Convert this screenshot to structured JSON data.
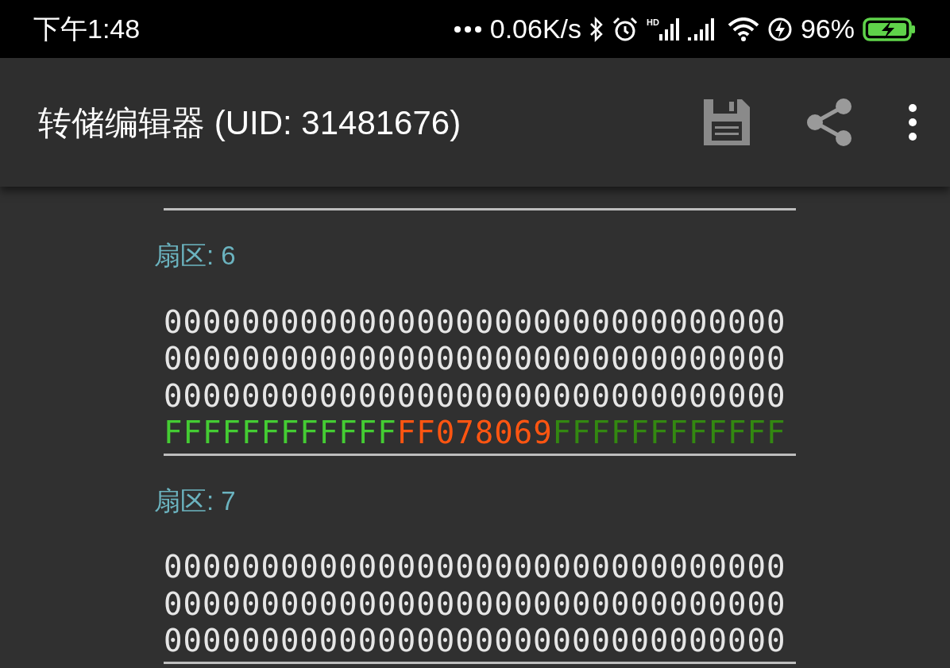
{
  "status_bar": {
    "time": "下午1:48",
    "speed": "0.06K/s",
    "signal_label": "HD",
    "battery": "96%"
  },
  "app_bar": {
    "title": "转储编辑器 (UID: 31481676)"
  },
  "sectors": [
    {
      "label": "扇区: 6",
      "rows": [
        {
          "kind": "data",
          "text": "00000000000000000000000000000000"
        },
        {
          "kind": "data",
          "text": "00000000000000000000000000000000"
        },
        {
          "kind": "data",
          "text": "00000000000000000000000000000000"
        },
        {
          "kind": "trailer",
          "segments": [
            {
              "text": "FFFFFFFFFFFF",
              "color": "#44cc33"
            },
            {
              "text": "FF078069",
              "color": "#ff5511"
            },
            {
              "text": "FFFFFFFFFFFF",
              "color": "#338811"
            }
          ]
        }
      ]
    },
    {
      "label": "扇区: 7",
      "rows": [
        {
          "kind": "data",
          "text": "00000000000000000000000000000000"
        },
        {
          "kind": "data",
          "text": "00000000000000000000000000000000"
        },
        {
          "kind": "data",
          "text": "00000000000000000000000000000000"
        }
      ]
    }
  ]
}
